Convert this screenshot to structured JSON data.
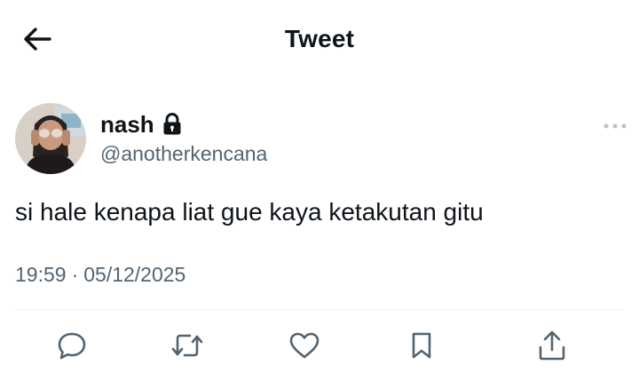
{
  "header": {
    "title": "Tweet",
    "back_icon": "arrow-left-icon"
  },
  "author": {
    "display_name": "nash",
    "username": "@anotherkencana",
    "protected_icon": "lock-icon",
    "avatar": "avatar"
  },
  "tweet": {
    "text": "si hale kenapa liat gue kaya ketakutan gitu",
    "time": "19:59",
    "separator": "·",
    "date": "05/12/2025"
  },
  "actions": [
    {
      "name": "reply",
      "icon": "reply-icon"
    },
    {
      "name": "retweet",
      "icon": "retweet-icon"
    },
    {
      "name": "like",
      "icon": "heart-icon"
    },
    {
      "name": "bookmark",
      "icon": "bookmark-icon"
    },
    {
      "name": "share",
      "icon": "share-icon"
    }
  ],
  "colors": {
    "text": "#0f1419",
    "secondary": "#536471",
    "divider": "#eff3f4"
  }
}
